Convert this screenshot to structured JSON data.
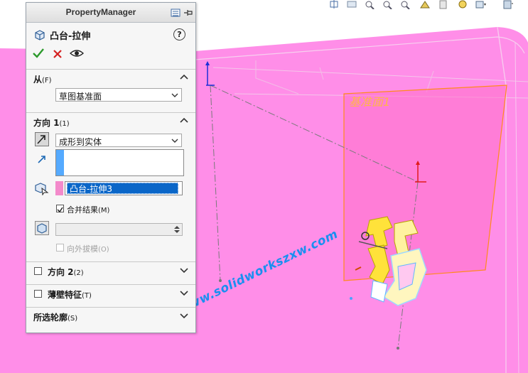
{
  "panel": {
    "title": "PropertyManager",
    "feature_title": "凸台-拉伸",
    "help": "?"
  },
  "from_section": {
    "label": "从",
    "shortcut": "(F)",
    "selected": "草图基准面"
  },
  "direction1": {
    "label": "方向 1",
    "shortcut": "(1)",
    "end_condition": "成形到实体",
    "direction_ref": "",
    "target_body": "凸台-拉伸3",
    "merge_label": "合并结果",
    "merge_shortcut": "(M)",
    "merge_checked": true,
    "draft_label": "向外拔模",
    "draft_shortcut": "(O)",
    "draft_checked": false
  },
  "direction2": {
    "label": "方向 2",
    "shortcut": "(2)",
    "checked": false
  },
  "thin_feature": {
    "label": "薄壁特征",
    "shortcut": "(T)",
    "checked": false
  },
  "selected_contours": {
    "label": "所选轮廓",
    "shortcut": "(S)"
  },
  "viewport": {
    "plane_label": "基准面1",
    "watermark": "www.solidworkszxw.com",
    "background_color": "#ff8ee8",
    "plane_color": "#ff6fc8",
    "plane_border_color": "#ff8a1a"
  },
  "colors": {
    "accept": "#2c9a2c",
    "cancel": "#d42020",
    "selection_highlight": "#0a66c8",
    "body_swatch": "#f38acb",
    "dir_swatch": "#55aaff"
  },
  "icons": {
    "feature": "boss-extrude-icon",
    "accept": "checkmark-icon",
    "cancel": "x-icon",
    "preview": "eye-icon"
  }
}
